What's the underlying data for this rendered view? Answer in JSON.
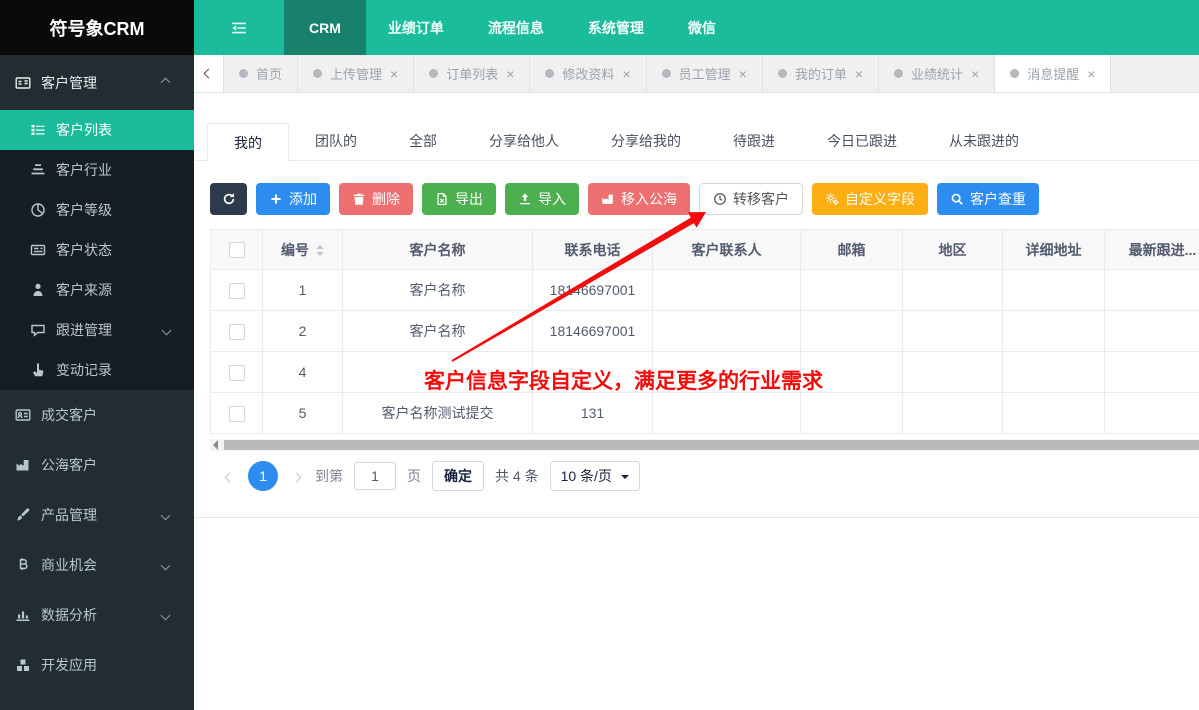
{
  "logo": {
    "title": "符号象CRM"
  },
  "topnav": {
    "items": [
      {
        "label": "CRM"
      },
      {
        "label": "业绩订单"
      },
      {
        "label": "流程信息"
      },
      {
        "label": "系统管理"
      },
      {
        "label": "微信"
      }
    ]
  },
  "tabbar": {
    "close": "×",
    "tabs": [
      {
        "label": "首页"
      },
      {
        "label": "上传管理"
      },
      {
        "label": "订单列表"
      },
      {
        "label": "修改资料"
      },
      {
        "label": "员工管理"
      },
      {
        "label": "我的订单"
      },
      {
        "label": "业绩统计"
      },
      {
        "label": "消息提醒"
      }
    ]
  },
  "sidebar": {
    "group": {
      "label": "客户管理"
    },
    "submenu": [
      {
        "label": "客户列表"
      },
      {
        "label": "客户行业"
      },
      {
        "label": "客户等级"
      },
      {
        "label": "客户状态"
      },
      {
        "label": "客户来源"
      },
      {
        "label": "跟进管理"
      },
      {
        "label": "变动记录"
      }
    ],
    "items": [
      {
        "label": "成交客户"
      },
      {
        "label": "公海客户"
      },
      {
        "label": "产品管理"
      },
      {
        "label": "商业机会"
      },
      {
        "label": "数据分析"
      },
      {
        "label": "开发应用"
      }
    ]
  },
  "view_tabs": [
    {
      "label": "我的"
    },
    {
      "label": "团队的"
    },
    {
      "label": "全部"
    },
    {
      "label": "分享给他人"
    },
    {
      "label": "分享给我的"
    },
    {
      "label": "待跟进"
    },
    {
      "label": "今日已跟进"
    },
    {
      "label": "从未跟进的"
    }
  ],
  "toolbar": {
    "add": "添加",
    "delete": "删除",
    "export": "导出",
    "import": "导入",
    "move_to_sea": "移入公海",
    "transfer": "转移客户",
    "custom_fields": "自定义字段",
    "dedupe": "客户查重"
  },
  "table": {
    "columns": {
      "id": "编号",
      "name": "客户名称",
      "phone": "联系电话",
      "contact": "客户联系人",
      "email": "邮箱",
      "region": "地区",
      "address": "详细地址",
      "follow": "最新跟进..."
    },
    "rows": [
      {
        "id": "1",
        "name": "客户名称",
        "phone": "18146697001",
        "contact": "",
        "email": "",
        "region": "",
        "address": "",
        "follow": ""
      },
      {
        "id": "2",
        "name": "客户名称",
        "phone": "18146697001",
        "contact": "",
        "email": "",
        "region": "",
        "address": "",
        "follow": ""
      },
      {
        "id": "4",
        "name": "",
        "phone": "",
        "contact": "",
        "email": "",
        "region": "",
        "address": "",
        "follow": ""
      },
      {
        "id": "5",
        "name": "客户名称测试提交",
        "phone": "131",
        "contact": "",
        "email": "",
        "region": "",
        "address": "",
        "follow": ""
      }
    ]
  },
  "annotation": {
    "text": "客户信息字段自定义，满足更多的行业需求"
  },
  "pagination": {
    "page": "1",
    "goto": "到第",
    "page_input": "1",
    "unit": "页",
    "confirm": "确定",
    "total": "共 4 条",
    "page_size": "10 条/页"
  },
  "colors": {
    "teal": "#1abc9c",
    "teal_dark": "#17816c",
    "sidebar": "#222d32",
    "blue": "#2d8cf0",
    "red": "#ee6f6f",
    "green": "#4cb050",
    "amber": "#fcae13",
    "dark": "#2d3a4b",
    "annotation_red": "#f20d0d"
  }
}
